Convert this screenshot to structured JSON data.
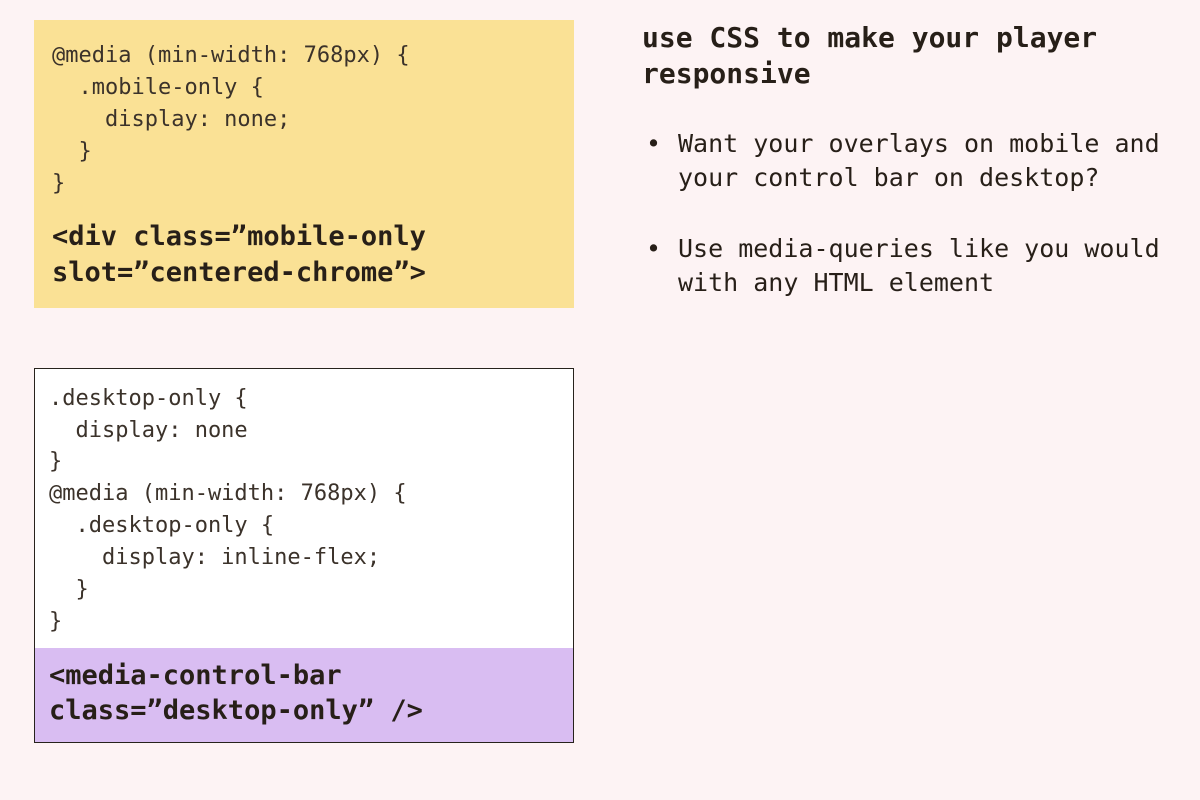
{
  "right": {
    "title": "use CSS to make your player responsive",
    "bullets": [
      "Want your overlays on mobile and your control bar on desktop?",
      "Use media-queries like you would with any HTML element"
    ]
  },
  "left": {
    "box1": {
      "code": "@media (min-width: 768px) {\n  .mobile-only {\n    display: none;\n  }\n}",
      "boldLine": "<div class=”mobile-only slot=”centered-chrome”>"
    },
    "box2": {
      "code": ".desktop-only {\n  display: none\n}\n@media (min-width: 768px) {\n  .desktop-only {\n    display: inline-flex;\n  }\n}",
      "boldLine": "<media-control-bar class=”desktop-only” />"
    }
  }
}
